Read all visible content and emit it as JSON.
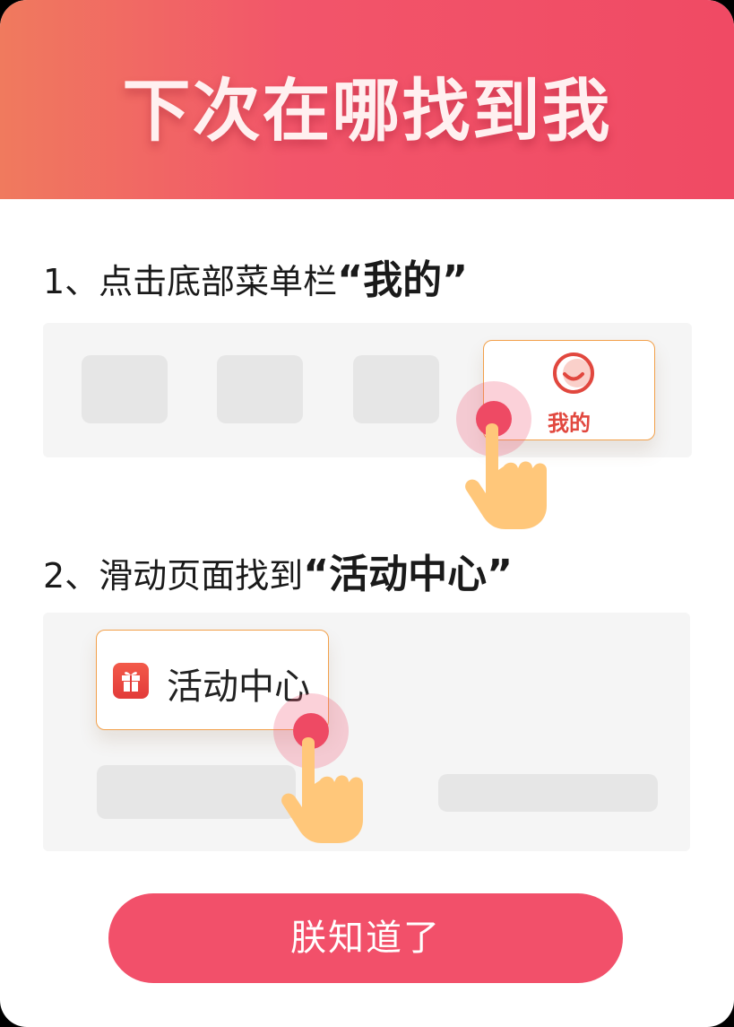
{
  "header": {
    "title": "下次在哪找到我"
  },
  "step1": {
    "text": "1、点击底部菜单栏",
    "quote": "“我的”"
  },
  "step2": {
    "text": "2、滑动页面找到",
    "quote": "“活动中心”"
  },
  "tab": {
    "label": "我的"
  },
  "activity": {
    "label": "活动中心"
  },
  "button": {
    "label": "朕知道了"
  },
  "colors": {
    "accent": "#f2506a",
    "tab_border": "#f2a04a",
    "tab_text": "#e1473e"
  },
  "icons": {
    "tab_icon": "smile-face-icon",
    "activity_icon": "gift-icon",
    "pointer": "tap-hand-icon"
  }
}
